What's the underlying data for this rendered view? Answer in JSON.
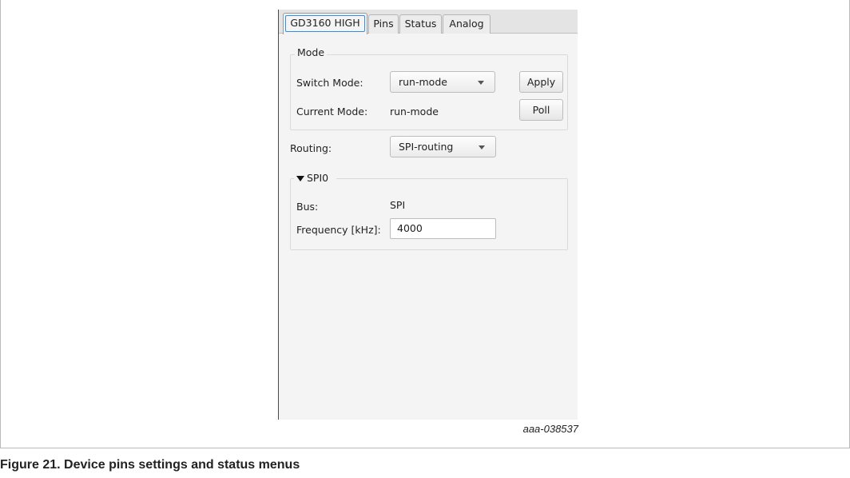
{
  "tabs": [
    {
      "label": "GD3160 HIGH",
      "active": true
    },
    {
      "label": "Pins",
      "active": false
    },
    {
      "label": "Status",
      "active": false
    },
    {
      "label": "Analog",
      "active": false
    }
  ],
  "mode": {
    "title": "Mode",
    "switch_label": "Switch Mode:",
    "switch_value": "run-mode",
    "apply_label": "Apply",
    "current_label": "Current Mode:",
    "current_value": "run-mode",
    "poll_label": "Poll"
  },
  "routing": {
    "label": "Routing:",
    "value": "SPI-routing"
  },
  "spi": {
    "title": "SPI0",
    "expanded": true,
    "bus_label": "Bus:",
    "bus_value": "SPI",
    "freq_label": "Frequency [kHz]:",
    "freq_value": "4000"
  },
  "figure": {
    "id": "aaa-038537",
    "caption": "Figure 21.  Device pins settings and status menus"
  },
  "icons": {
    "dropdown": "chevron-down-icon",
    "collapse": "triangle-down-icon"
  },
  "colors": {
    "focus_ring": "#2e8ee8",
    "panel_bg": "#f4f4f4"
  }
}
